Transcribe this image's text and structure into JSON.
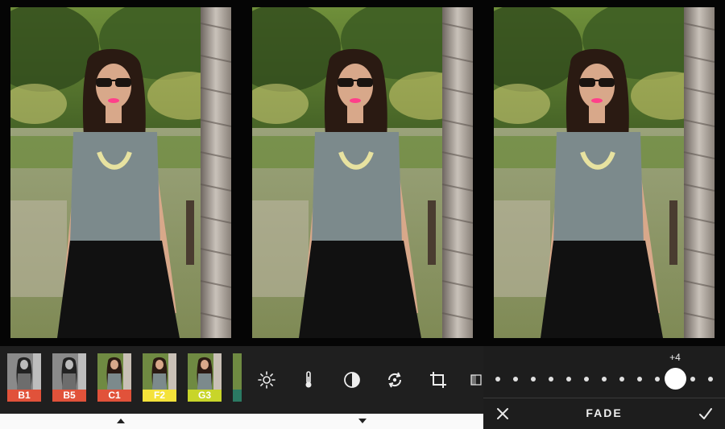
{
  "editor_left": {
    "presets": [
      {
        "label": "B1",
        "color": "#e1523a",
        "text_color": "#ffffff",
        "tone": "bw"
      },
      {
        "label": "B5",
        "color": "#e1523a",
        "text_color": "#ffffff",
        "tone": "bw"
      },
      {
        "label": "C1",
        "color": "#e1523a",
        "text_color": "#ffffff",
        "tone": "color"
      },
      {
        "label": "F2",
        "color": "#f4e23a",
        "text_color": "#ffffff",
        "tone": "color"
      },
      {
        "label": "G3",
        "color": "#c8d52a",
        "text_color": "#ffffff",
        "tone": "color"
      },
      {
        "label": "",
        "color": "#2b7a63",
        "text_color": "#ffffff",
        "tone": "color"
      }
    ]
  },
  "editor_middle": {
    "tools": [
      {
        "icon": "brightness-icon"
      },
      {
        "icon": "temperature-icon"
      },
      {
        "icon": "contrast-icon"
      },
      {
        "icon": "rotate-icon"
      },
      {
        "icon": "crop-icon"
      },
      {
        "icon": "fade-tool-icon"
      }
    ]
  },
  "editor_right": {
    "adjust": {
      "title": "FADE",
      "value_label": "+4",
      "value": 4,
      "min": -6,
      "max": 6,
      "cancel_icon": "close-icon",
      "confirm_icon": "check-icon"
    }
  },
  "nav": {
    "left_indicator": "up-caret-icon",
    "middle_indicator": "down-caret-icon"
  }
}
